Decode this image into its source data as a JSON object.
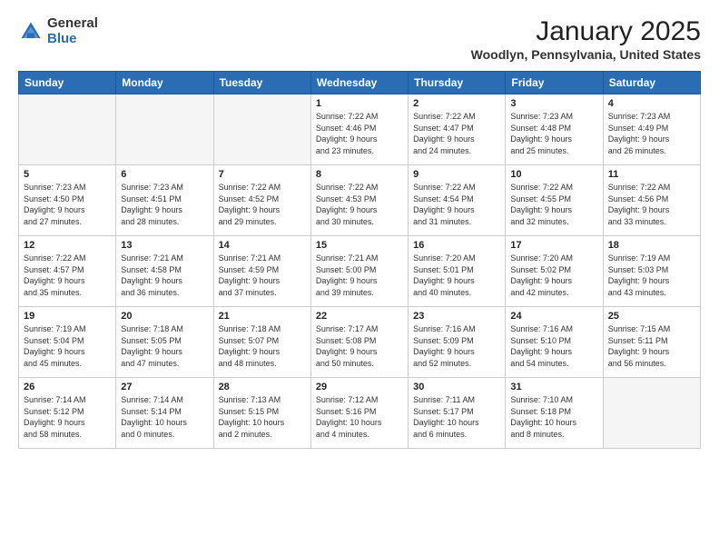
{
  "header": {
    "logo_general": "General",
    "logo_blue": "Blue",
    "month_title": "January 2025",
    "location": "Woodlyn, Pennsylvania, United States"
  },
  "weekdays": [
    "Sunday",
    "Monday",
    "Tuesday",
    "Wednesday",
    "Thursday",
    "Friday",
    "Saturday"
  ],
  "weeks": [
    [
      {
        "day": "",
        "detail": ""
      },
      {
        "day": "",
        "detail": ""
      },
      {
        "day": "",
        "detail": ""
      },
      {
        "day": "1",
        "detail": "Sunrise: 7:22 AM\nSunset: 4:46 PM\nDaylight: 9 hours\nand 23 minutes."
      },
      {
        "day": "2",
        "detail": "Sunrise: 7:22 AM\nSunset: 4:47 PM\nDaylight: 9 hours\nand 24 minutes."
      },
      {
        "day": "3",
        "detail": "Sunrise: 7:23 AM\nSunset: 4:48 PM\nDaylight: 9 hours\nand 25 minutes."
      },
      {
        "day": "4",
        "detail": "Sunrise: 7:23 AM\nSunset: 4:49 PM\nDaylight: 9 hours\nand 26 minutes."
      }
    ],
    [
      {
        "day": "5",
        "detail": "Sunrise: 7:23 AM\nSunset: 4:50 PM\nDaylight: 9 hours\nand 27 minutes."
      },
      {
        "day": "6",
        "detail": "Sunrise: 7:23 AM\nSunset: 4:51 PM\nDaylight: 9 hours\nand 28 minutes."
      },
      {
        "day": "7",
        "detail": "Sunrise: 7:22 AM\nSunset: 4:52 PM\nDaylight: 9 hours\nand 29 minutes."
      },
      {
        "day": "8",
        "detail": "Sunrise: 7:22 AM\nSunset: 4:53 PM\nDaylight: 9 hours\nand 30 minutes."
      },
      {
        "day": "9",
        "detail": "Sunrise: 7:22 AM\nSunset: 4:54 PM\nDaylight: 9 hours\nand 31 minutes."
      },
      {
        "day": "10",
        "detail": "Sunrise: 7:22 AM\nSunset: 4:55 PM\nDaylight: 9 hours\nand 32 minutes."
      },
      {
        "day": "11",
        "detail": "Sunrise: 7:22 AM\nSunset: 4:56 PM\nDaylight: 9 hours\nand 33 minutes."
      }
    ],
    [
      {
        "day": "12",
        "detail": "Sunrise: 7:22 AM\nSunset: 4:57 PM\nDaylight: 9 hours\nand 35 minutes."
      },
      {
        "day": "13",
        "detail": "Sunrise: 7:21 AM\nSunset: 4:58 PM\nDaylight: 9 hours\nand 36 minutes."
      },
      {
        "day": "14",
        "detail": "Sunrise: 7:21 AM\nSunset: 4:59 PM\nDaylight: 9 hours\nand 37 minutes."
      },
      {
        "day": "15",
        "detail": "Sunrise: 7:21 AM\nSunset: 5:00 PM\nDaylight: 9 hours\nand 39 minutes."
      },
      {
        "day": "16",
        "detail": "Sunrise: 7:20 AM\nSunset: 5:01 PM\nDaylight: 9 hours\nand 40 minutes."
      },
      {
        "day": "17",
        "detail": "Sunrise: 7:20 AM\nSunset: 5:02 PM\nDaylight: 9 hours\nand 42 minutes."
      },
      {
        "day": "18",
        "detail": "Sunrise: 7:19 AM\nSunset: 5:03 PM\nDaylight: 9 hours\nand 43 minutes."
      }
    ],
    [
      {
        "day": "19",
        "detail": "Sunrise: 7:19 AM\nSunset: 5:04 PM\nDaylight: 9 hours\nand 45 minutes."
      },
      {
        "day": "20",
        "detail": "Sunrise: 7:18 AM\nSunset: 5:05 PM\nDaylight: 9 hours\nand 47 minutes."
      },
      {
        "day": "21",
        "detail": "Sunrise: 7:18 AM\nSunset: 5:07 PM\nDaylight: 9 hours\nand 48 minutes."
      },
      {
        "day": "22",
        "detail": "Sunrise: 7:17 AM\nSunset: 5:08 PM\nDaylight: 9 hours\nand 50 minutes."
      },
      {
        "day": "23",
        "detail": "Sunrise: 7:16 AM\nSunset: 5:09 PM\nDaylight: 9 hours\nand 52 minutes."
      },
      {
        "day": "24",
        "detail": "Sunrise: 7:16 AM\nSunset: 5:10 PM\nDaylight: 9 hours\nand 54 minutes."
      },
      {
        "day": "25",
        "detail": "Sunrise: 7:15 AM\nSunset: 5:11 PM\nDaylight: 9 hours\nand 56 minutes."
      }
    ],
    [
      {
        "day": "26",
        "detail": "Sunrise: 7:14 AM\nSunset: 5:12 PM\nDaylight: 9 hours\nand 58 minutes."
      },
      {
        "day": "27",
        "detail": "Sunrise: 7:14 AM\nSunset: 5:14 PM\nDaylight: 10 hours\nand 0 minutes."
      },
      {
        "day": "28",
        "detail": "Sunrise: 7:13 AM\nSunset: 5:15 PM\nDaylight: 10 hours\nand 2 minutes."
      },
      {
        "day": "29",
        "detail": "Sunrise: 7:12 AM\nSunset: 5:16 PM\nDaylight: 10 hours\nand 4 minutes."
      },
      {
        "day": "30",
        "detail": "Sunrise: 7:11 AM\nSunset: 5:17 PM\nDaylight: 10 hours\nand 6 minutes."
      },
      {
        "day": "31",
        "detail": "Sunrise: 7:10 AM\nSunset: 5:18 PM\nDaylight: 10 hours\nand 8 minutes."
      },
      {
        "day": "",
        "detail": ""
      }
    ]
  ]
}
